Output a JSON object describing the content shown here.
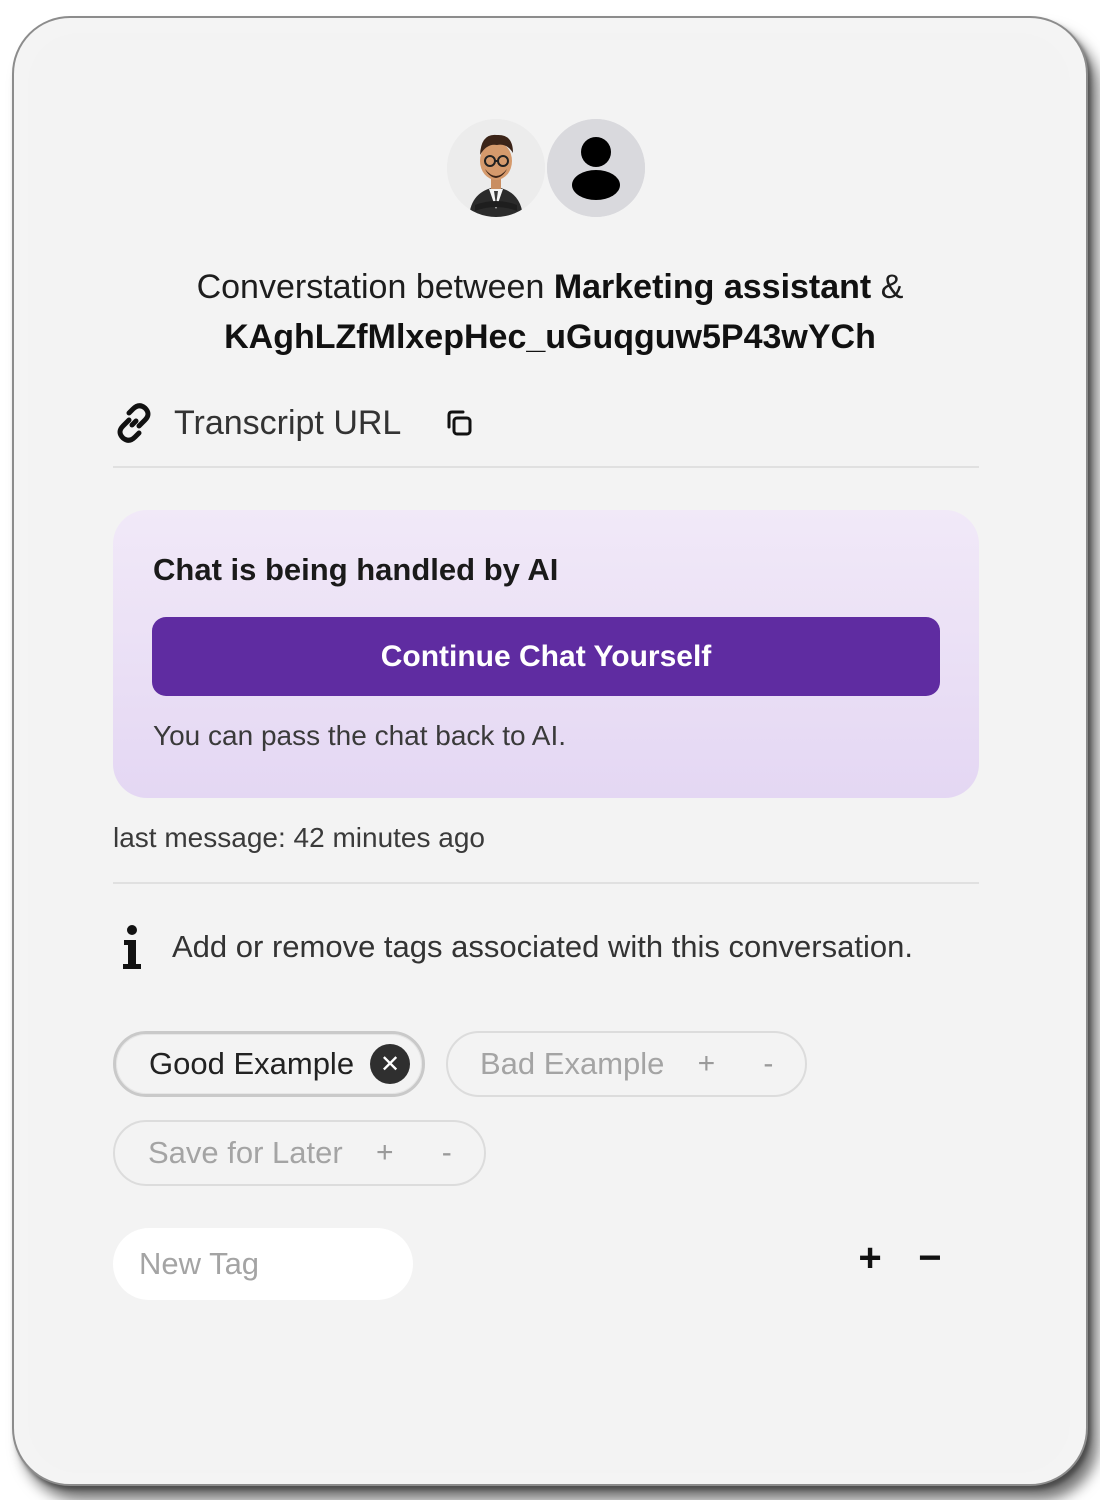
{
  "header": {
    "title_prefix": "Converstation between ",
    "assistant_name": "Marketing assistant",
    "title_joiner": " &",
    "user_id": "KAghLZfMlxepHec_uGuqguw5P43wYCh"
  },
  "avatars": {
    "bot": "bot-avatar",
    "user": "user-icon"
  },
  "transcript": {
    "label": "Transcript URL",
    "link_icon": "link-icon",
    "copy_icon": "copy-icon"
  },
  "ai_card": {
    "title": "Chat is being handled by AI",
    "button_label": "Continue Chat Yourself",
    "note": "You can pass the chat back to AI.",
    "accent_color": "#5f2ca1"
  },
  "last_message": "last message: 42 minutes ago",
  "tags_info": {
    "icon": "info-icon",
    "text": "Add or remove tags associated with this conversation."
  },
  "tags": [
    {
      "label": "Good Example",
      "active": true,
      "remove_symbol": "✕"
    },
    {
      "label": "Bad Example",
      "active": false,
      "add_symbol": "+",
      "remove_symbol": "-"
    },
    {
      "label": "Save for Later",
      "active": false,
      "add_symbol": "+",
      "remove_symbol": "-"
    }
  ],
  "new_tag": {
    "placeholder": "New Tag",
    "add_symbol": "+",
    "remove_symbol": "−"
  }
}
